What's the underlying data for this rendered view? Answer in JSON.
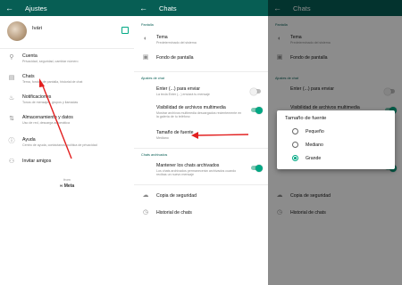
{
  "colors": {
    "accent": "#075e54",
    "toggle_on": "#00a884",
    "arrow": "#e21f1f"
  },
  "settings": {
    "title": "Ajustes",
    "profile": {
      "name": "Ivári"
    },
    "items": [
      {
        "icon": "key-icon",
        "label": "Cuenta",
        "sub": "Privacidad, seguridad, cambiar número"
      },
      {
        "icon": "chat-icon",
        "label": "Chats",
        "sub": "Tema, fondos de pantalla, historial de chat"
      },
      {
        "icon": "bell-icon",
        "label": "Notificaciones",
        "sub": "Tonos de mensajes, grupos y llamadas"
      },
      {
        "icon": "storage-icon",
        "label": "Almacenamiento y datos",
        "sub": "Uso de red, descarga automática"
      },
      {
        "icon": "help-icon",
        "label": "Ayuda",
        "sub": "Centro de ayuda, contáctanos, política de privacidad"
      },
      {
        "icon": "people-icon",
        "label": "Invitar amigos",
        "sub": ""
      }
    ],
    "footer_from": "from",
    "footer_brand": "∞ Meta"
  },
  "chats": {
    "title": "Chats",
    "section_display": "Pantalla",
    "theme_label": "Tema",
    "theme_value": "Predeterminado del sistema",
    "wallpaper_label": "Fondo de pantalla",
    "section_settings": "Ajustes de chat",
    "enter_label": "Enter (...) para enviar",
    "enter_sub": "La tecla Enter (...) enviará tu mensaje",
    "media_label": "Visibilidad de archivos multimedia",
    "media_sub": "Mostrar archivos multimedia descargados recientemente en la galería de tu teléfono",
    "font_label": "Tamaño de fuente",
    "font_value": "Mediano",
    "section_archived": "Chats archivados",
    "archived_label": "Mantener los chats archivados",
    "archived_sub": "Los chats archivados permanecerán archivados cuando recibas un nuevo mensaje",
    "backup_label": "Copia de seguridad",
    "history_label": "Historial de chats"
  },
  "font_dialog": {
    "title": "Tamaño de fuente",
    "options": [
      "Pequeño",
      "Mediano",
      "Grande"
    ],
    "selected": "Grande"
  }
}
